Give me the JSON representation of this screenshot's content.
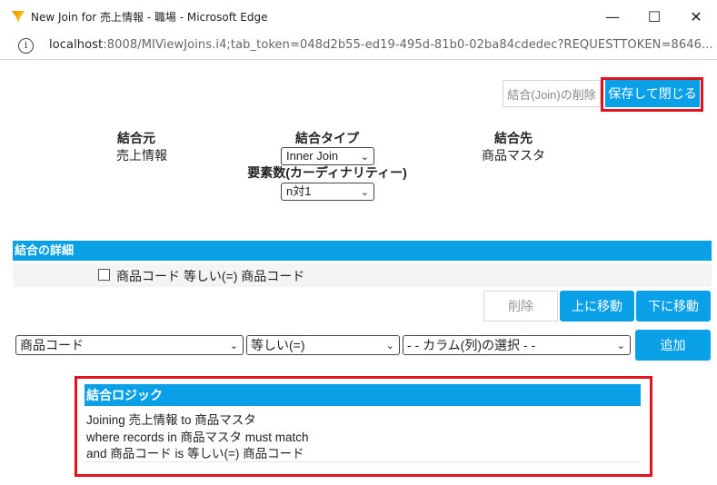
{
  "window": {
    "title": "New Join for 売上情報 - 職場 - Microsoft Edge",
    "minimize_glyph": "—",
    "maximize_glyph": "☐",
    "close_glyph": "✕"
  },
  "address": {
    "info_glyph": "i",
    "host": "localhost",
    "rest": ":8008/MIViewJoins.i4;tab_token=048d2b55-ed19-495d-81b0-02ba84cdedec?REQUESTTOKEN=8646..."
  },
  "toolbar": {
    "delete_join_label": "結合(Join)の削除",
    "save_close_label": "保存して閉じる"
  },
  "join": {
    "source_label": "結合元",
    "source_value": "売上情報",
    "type_label": "結合タイプ",
    "type_selected": "Inner Join",
    "cardinality_label": "要素数(カーディナリティー)",
    "cardinality_selected": "n対1",
    "target_label": "結合先",
    "target_value": "商品マスタ"
  },
  "details": {
    "section_title": "結合の詳細",
    "condition_text": "商品コード 等しい(=) 商品コード",
    "delete_label": "削除",
    "move_up_label": "上に移動",
    "move_down_label": "下に移動",
    "left_column_selected": "商品コード",
    "operator_selected": "等しい(=)",
    "right_column_selected": "- - カラム(列)の選択 - -",
    "add_label": "追加"
  },
  "logic": {
    "title": "結合ロジック",
    "line1": "Joining 売上情報 to 商品マスタ",
    "line2": "where records in 商品マスタ must match",
    "line3": "and 商品コード is 等しい(=) 商品コード"
  },
  "icons": {
    "app": "edge-favicon-icon",
    "chevron": "⌄"
  },
  "colors": {
    "accent": "#0aa0e8",
    "highlight": "#e0141e"
  }
}
